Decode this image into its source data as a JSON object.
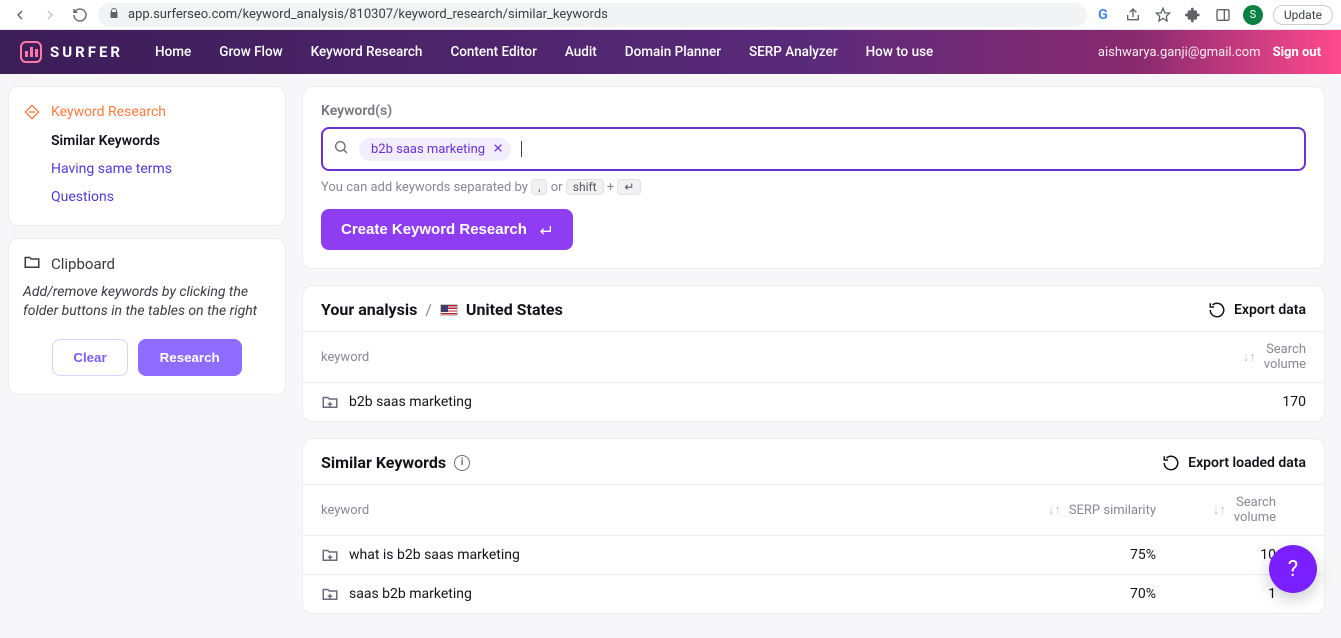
{
  "chrome": {
    "url": "app.surferseo.com/keyword_analysis/810307/keyword_research/similar_keywords",
    "avatar_letter": "S",
    "update": "Update"
  },
  "nav": {
    "brand": "SURFER",
    "links": [
      "Home",
      "Grow Flow",
      "Keyword Research",
      "Content Editor",
      "Audit",
      "Domain Planner",
      "SERP Analyzer",
      "How to use"
    ],
    "email": "aishwarya.ganji@gmail.com",
    "signout": "Sign out"
  },
  "sidebar": {
    "section": "Keyword Research",
    "items": [
      "Similar Keywords",
      "Having same terms",
      "Questions"
    ],
    "clipboard": {
      "title": "Clipboard",
      "desc": "Add/remove keywords by clicking the folder buttons in the tables on the right",
      "clear": "Clear",
      "research": "Research"
    }
  },
  "keywords_panel": {
    "label": "Keyword(s)",
    "chip": "b2b saas marketing",
    "hint_pre": "You can add keywords separated by ",
    "hint_comma": ",",
    "hint_or": " or ",
    "hint_shift": "shift",
    "hint_plus": " + ",
    "hint_enter": "↵",
    "create": "Create Keyword Research"
  },
  "analysis": {
    "title_lead": "Your analysis",
    "slash": "/",
    "country": "United States",
    "export": "Export data",
    "col_keyword": "keyword",
    "col_volume_l1": "Search",
    "col_volume_l2": "volume",
    "rows": [
      {
        "kw": "b2b saas marketing",
        "vol": "170"
      }
    ]
  },
  "similar": {
    "title": "Similar Keywords",
    "export": "Export loaded data",
    "col_keyword": "keyword",
    "col_serp": "SERP similarity",
    "col_volume_l1": "Search",
    "col_volume_l2": "volume",
    "rows": [
      {
        "kw": "what is b2b saas marketing",
        "serp": "75%",
        "vol": "10"
      },
      {
        "kw": "saas b2b marketing",
        "serp": "70%",
        "vol": "1"
      }
    ]
  },
  "help": "?"
}
